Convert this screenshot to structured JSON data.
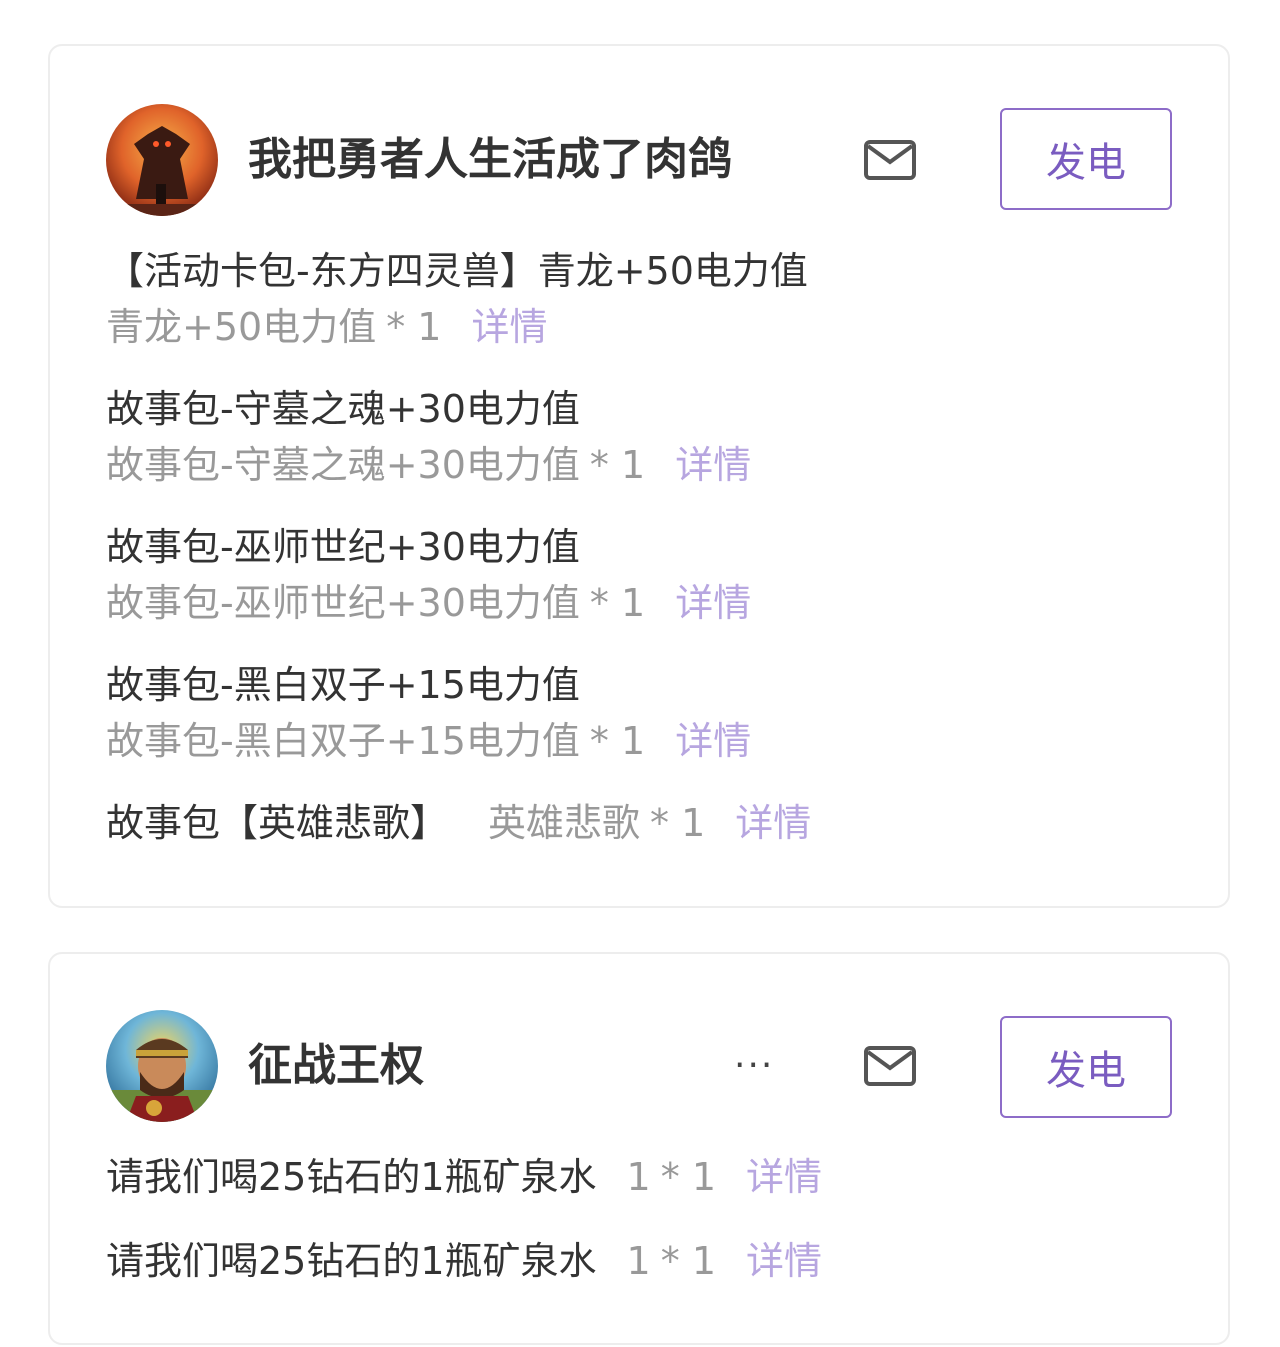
{
  "cards": [
    {
      "name": "我把勇者人生活成了肉鸽",
      "avatar_icon": "pixel-art-demon-avatar",
      "button_label": "发电",
      "items": [
        {
          "title": "【活动卡包-东方四灵兽】青龙+50电力值",
          "sub": "青龙+50电力值",
          "qty": "* 1",
          "detail": "详情"
        },
        {
          "title": "故事包-守墓之魂+30电力值",
          "sub": "故事包-守墓之魂+30电力值",
          "qty": "* 1",
          "detail": "详情"
        },
        {
          "title": "故事包-巫师世纪+30电力值",
          "sub": "故事包-巫师世纪+30电力值",
          "qty": "* 1",
          "detail": "详情"
        },
        {
          "title": "故事包-黑白双子+15电力值",
          "sub": "故事包-黑白双子+15电力值",
          "qty": "* 1",
          "detail": "详情"
        },
        {
          "title": "故事包【英雄悲歌】",
          "sub": "英雄悲歌",
          "qty": "* 1",
          "detail": "详情"
        }
      ]
    },
    {
      "name": "征战王权",
      "avatar_icon": "pixel-art-king-avatar",
      "more_label": "···",
      "button_label": "发电",
      "items": [
        {
          "title": "请我们喝25钻石的1瓶矿泉水",
          "sub": "1",
          "qty": "* 1",
          "detail": "详情"
        },
        {
          "title": "请我们喝25钻石的1瓶矿泉水",
          "sub": "1",
          "qty": "* 1",
          "detail": "详情"
        }
      ]
    }
  ],
  "colors": {
    "accent": "#7a5cc0",
    "detail": "#b7a6e0",
    "muted": "#999999"
  }
}
